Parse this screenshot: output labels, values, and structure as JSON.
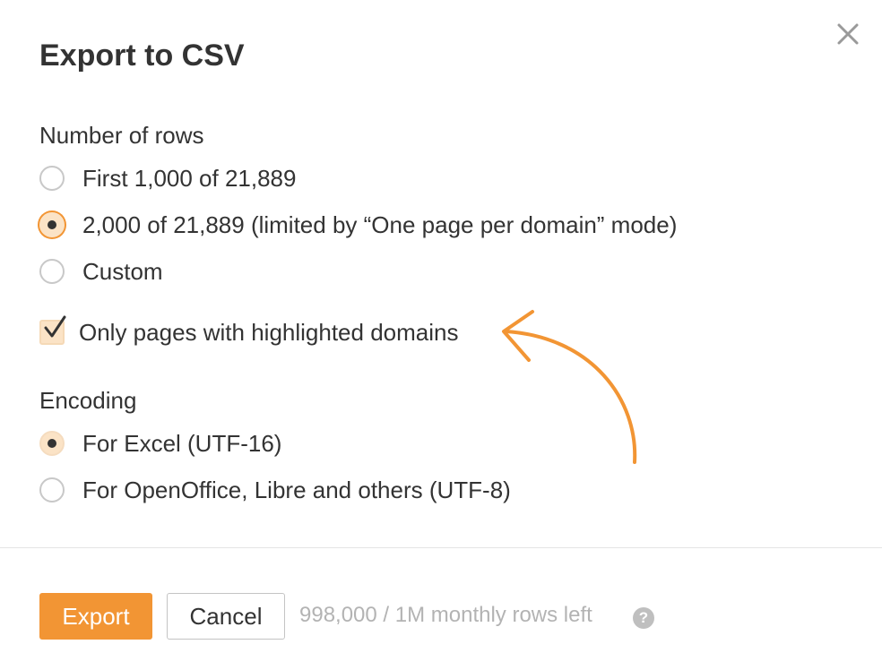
{
  "dialog": {
    "title": "Export to CSV",
    "close_icon": "close-icon"
  },
  "rows_section": {
    "label": "Number of rows",
    "options": [
      {
        "label": "First 1,000 of 21,889",
        "selected": false
      },
      {
        "label": "2,000 of 21,889 (limited by “One page per domain” mode)",
        "selected": true
      },
      {
        "label": "Custom",
        "selected": false
      }
    ],
    "highlighted_checkbox": {
      "label": "Only pages with highlighted domains",
      "checked": true
    }
  },
  "encoding_section": {
    "label": "Encoding",
    "options": [
      {
        "label": "For Excel (UTF-16)",
        "selected": true
      },
      {
        "label": "For OpenOffice, Libre and others (UTF-8)",
        "selected": false
      }
    ]
  },
  "footer": {
    "export_label": "Export",
    "cancel_label": "Cancel",
    "rows_left_text": "998,000 / 1M monthly rows left",
    "help_glyph": "?"
  },
  "colors": {
    "accent": "#f29534",
    "selected_fill": "#fbe3c6",
    "muted_text": "#b3b3b3",
    "text": "#333333"
  }
}
